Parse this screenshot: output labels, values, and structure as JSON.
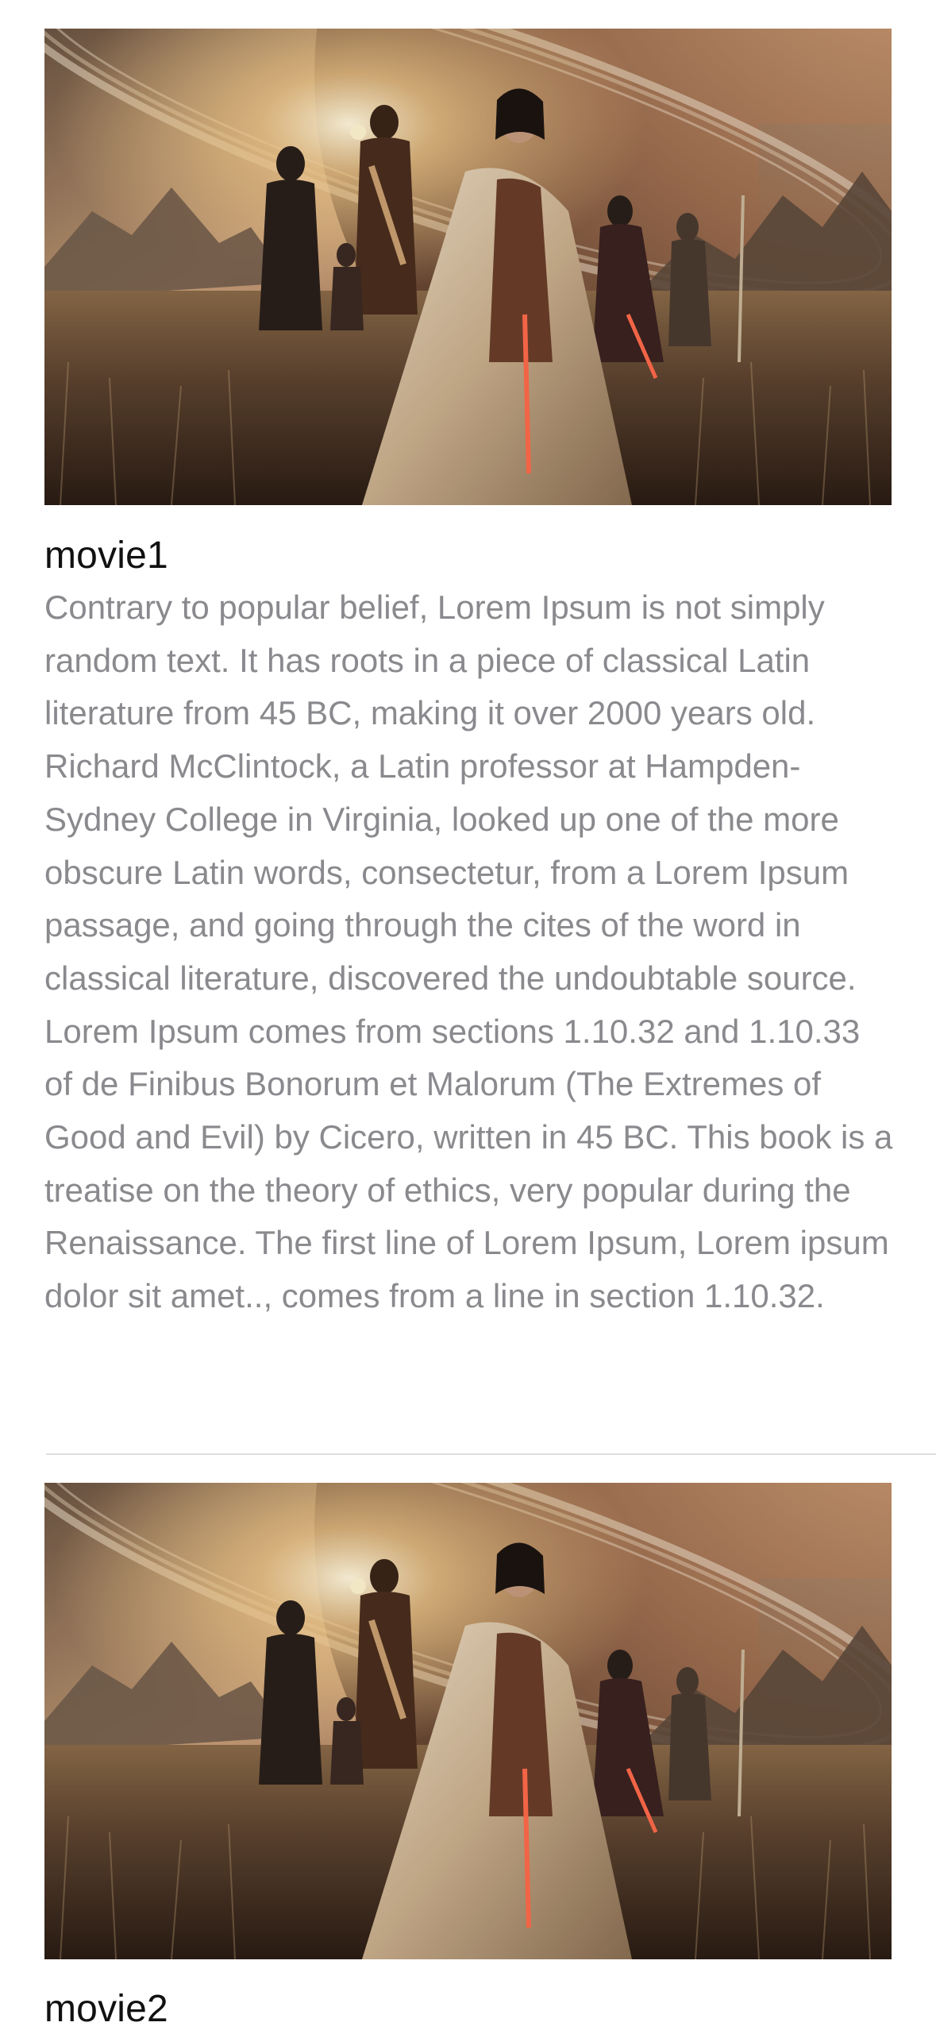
{
  "movies": [
    {
      "title": "movie1",
      "poster_icon": "movie-poster-image",
      "description": "Contrary to popular belief, Lorem Ipsum is not simply random text. It has roots in a piece of classical Latin literature from 45 BC, making it over 2000 years old. Richard McClintock, a Latin professor at Hampden-Sydney College in Virginia, looked up one of the more obscure Latin words, consectetur, from a Lorem Ipsum passage, and going through the cites of the word in classical literature, discovered the undoubtable source. Lorem Ipsum comes from sections 1.10.32 and 1.10.33 of de Finibus Bonorum et Malorum (The Extremes of Good and Evil) by Cicero, written in 45 BC. This book is a treatise on the theory of ethics, very popular during the Renaissance. The first line of Lorem Ipsum, Lorem ipsum dolor sit amet.., comes from a line in section 1.10.32."
    },
    {
      "title": "movie2",
      "poster_icon": "movie-poster-image",
      "description": ""
    }
  ],
  "colors": {
    "title": "#111111",
    "description": "#8a8a8e",
    "separator": "#dedee2",
    "background": "#ffffff"
  }
}
